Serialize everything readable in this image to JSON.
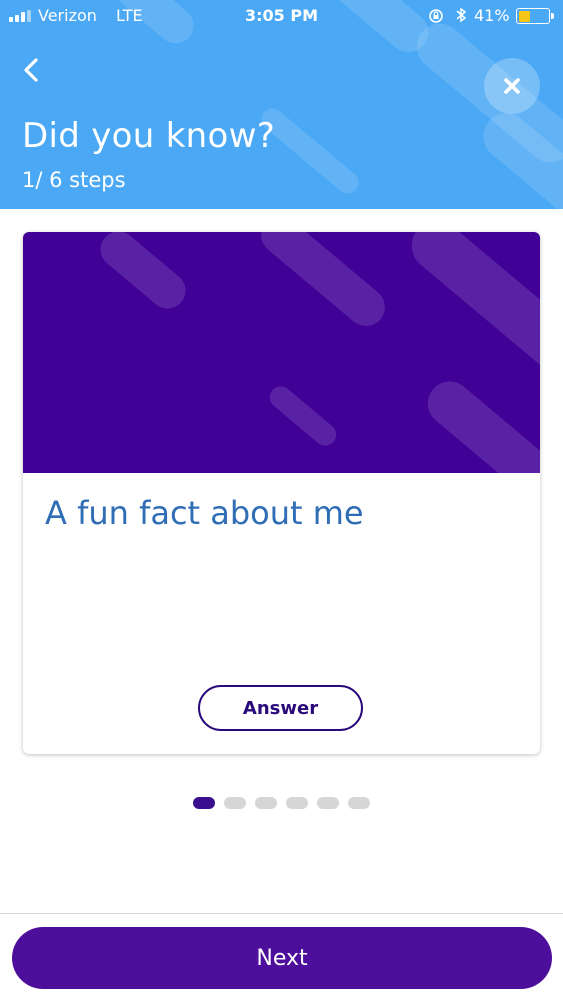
{
  "status_bar": {
    "carrier": "Verizon",
    "network": "LTE",
    "time": "3:05 PM",
    "battery": "41%",
    "battery_level": 0.41,
    "icons": [
      "signal-icon",
      "orientation-lock-icon",
      "bluetooth-icon",
      "battery-icon"
    ]
  },
  "header": {
    "title": "Did you know?",
    "steps": "1/  6 steps",
    "back_icon": "chevron-left-icon",
    "close_icon": "close-icon",
    "background_color": "#4aa8f5"
  },
  "card": {
    "title": "A fun fact about me",
    "answer_label": "Answer",
    "banner_color": "#410096",
    "title_color": "#2f6db5"
  },
  "pager": {
    "total": 6,
    "current": 1
  },
  "footer": {
    "next_label": "Next",
    "button_color": "#4d0f9b"
  }
}
